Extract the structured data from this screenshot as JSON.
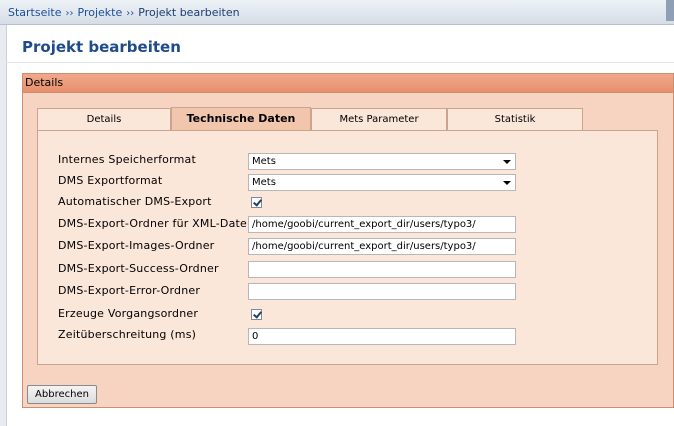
{
  "breadcrumb": {
    "items": [
      "Startseite",
      "Projekte"
    ],
    "separator": "››",
    "current": "Projekt bearbeiten"
  },
  "page_title": "Projekt bearbeiten",
  "panel": {
    "header": "Details",
    "tabs": [
      "Details",
      "Technische Daten",
      "Mets Parameter",
      "Statistik"
    ],
    "active_tab": "Technische Daten"
  },
  "form": {
    "internes_speicherformat": {
      "label": "Internes Speicherformat",
      "value": "Mets"
    },
    "dms_exportformat": {
      "label": "DMS Exportformat",
      "value": "Mets"
    },
    "automatischer_export": {
      "label": "Automatischer DMS-Export",
      "checked": true
    },
    "export_ordner_xml": {
      "label": "DMS-Export-Ordner für XML-Datei",
      "value": "/home/goobi/current_export_dir/users/typo3/"
    },
    "export_images_ordner": {
      "label": "DMS-Export-Images-Ordner",
      "value": "/home/goobi/current_export_dir/users/typo3/"
    },
    "export_success_ordner": {
      "label": "DMS-Export-Success-Ordner",
      "value": ""
    },
    "export_error_ordner": {
      "label": "DMS-Export-Error-Ordner",
      "value": ""
    },
    "vorgangsordner": {
      "label": "Erzeuge Vorgangsordner",
      "checked": true
    },
    "zeitueberschreitung": {
      "label": "Zeitüberschreitung (ms)",
      "value": "0"
    }
  },
  "buttons": {
    "cancel": "Abbrechen"
  },
  "colors": {
    "panel_bg": "#f7d4c2",
    "panel_header": "#e88f6d",
    "title_blue": "#1f4a8c"
  }
}
